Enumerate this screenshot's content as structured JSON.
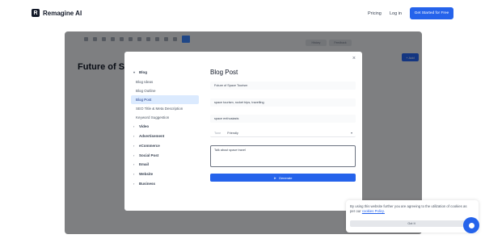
{
  "nav": {
    "brand_logo": "R",
    "brand_name": "Remagine AI",
    "pricing": "Pricing",
    "login": "Log in",
    "cta": "Get Started for Free"
  },
  "editor": {
    "doc_title": "Future of Spa",
    "add_label": "+ Add",
    "tb_right_1": "History",
    "tb_right_2": "Feedback"
  },
  "modal": {
    "close": "×",
    "title": "Blog Post",
    "categories": [
      {
        "label": "Blog",
        "expanded": true,
        "subitems": [
          "Blog Ideas",
          "Blog Outline",
          "Blog Post",
          "SEO Title & Meta Description",
          "Keyword Suggestion"
        ]
      },
      {
        "label": "Video"
      },
      {
        "label": "Advertisement"
      },
      {
        "label": "eCommerce"
      },
      {
        "label": "Social Post"
      },
      {
        "label": "Email"
      },
      {
        "label": "Website"
      },
      {
        "label": "Business"
      }
    ],
    "active_subitem": "Blog Post",
    "fields": {
      "topic": "Future of Space Tourism",
      "keywords": "space tourism, rocket trips, travelling",
      "audience": "space enthusiasts",
      "tone_label": "Tone",
      "tone_value": "Friendly",
      "textarea": "Talk about space travel"
    },
    "generate_label": "Generate"
  },
  "cookie": {
    "text": "By using this website further you are agreeing to the utilization of cookies as per our",
    "link": "cookies Policy.",
    "button": "Got It"
  },
  "colors": {
    "accent": "#2563eb",
    "overlay": "rgba(0,0,0,0.45)"
  }
}
